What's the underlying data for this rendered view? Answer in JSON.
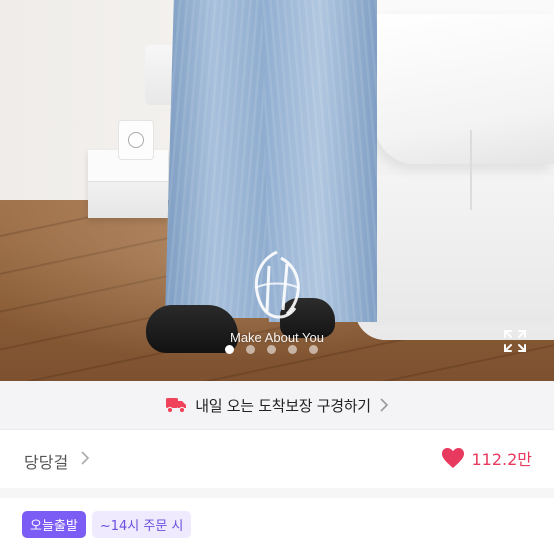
{
  "photo": {
    "watermark_text": "Make About You",
    "carousel": {
      "total": 5,
      "active_index": 0
    }
  },
  "banner": {
    "text": "내일 오는 도착보장 구경하기",
    "icon": "truck-icon"
  },
  "seller": {
    "name": "당당걸",
    "likes": "112.2만"
  },
  "shipping": {
    "today_badge": "오늘출발",
    "cutoff_text": "~14시 주문 시"
  },
  "colors": {
    "accent_pink": "#e8395f",
    "accent_purple": "#7b5cf5",
    "truck_red": "#f0435b"
  }
}
